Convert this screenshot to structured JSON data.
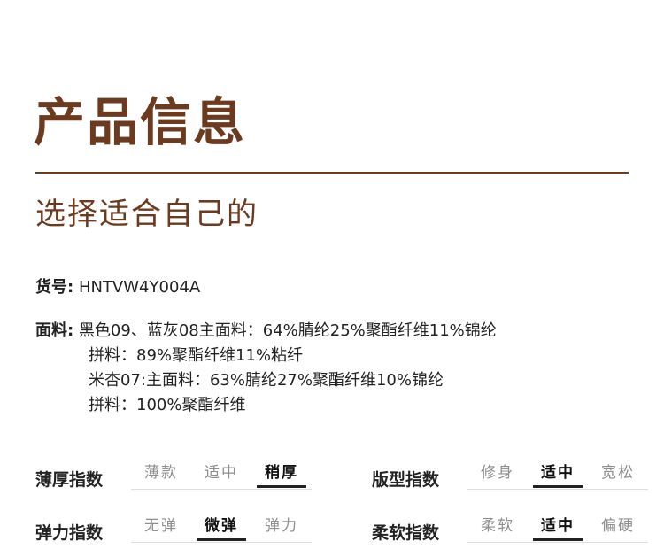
{
  "title": "产品信息",
  "subtitle": "选择适合自己的",
  "info": {
    "sku_label": "货号:",
    "sku_value": "HNTVW4Y004A",
    "fabric_label": "面料:",
    "fabric_lines": [
      "黑色09、蓝灰08主面料：64%腈纶25%聚酯纤维11%锦纶",
      "拼料：89%聚酯纤维11%粘纤",
      "米杏07:主面料：63%腈纶27%聚酯纤维10%锦纶",
      "拼料：100%聚酯纤维"
    ]
  },
  "metrics": [
    {
      "label": "薄厚指数",
      "options": [
        "薄款",
        "适中",
        "稍厚"
      ],
      "selected": "稍厚"
    },
    {
      "label": "版型指数",
      "options": [
        "修身",
        "适中",
        "宽松"
      ],
      "selected": "适中"
    },
    {
      "label": "弹力指数",
      "options": [
        "无弹",
        "微弹",
        "弹力"
      ],
      "selected": "微弹"
    },
    {
      "label": "柔软指数",
      "options": [
        "柔软",
        "适中",
        "偏硬"
      ],
      "selected": "适中"
    }
  ],
  "colors": {
    "accent": "#6b3a1f",
    "text": "#222222",
    "muted": "#8e8e8e"
  }
}
